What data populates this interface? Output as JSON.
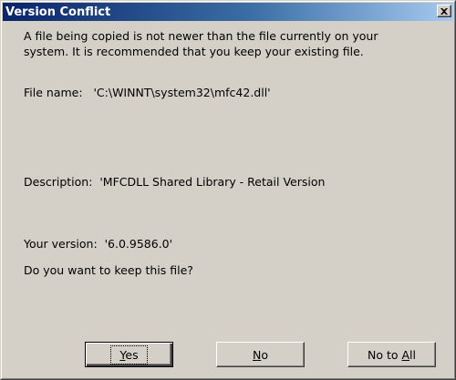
{
  "window": {
    "title": "Version Conflict",
    "close_icon": "close-icon"
  },
  "message": {
    "line1": "A file being copied is not newer than the file currently on your",
    "line2": "system. It is recommended that you keep your existing file."
  },
  "file": {
    "label": "File name:",
    "value": "'C:\\WINNT\\system32\\mfc42.dll'"
  },
  "description": {
    "label": "Description:",
    "value": "'MFCDLL Shared Library - Retail Version"
  },
  "version": {
    "label": "Your version:",
    "value": "'6.0.9586.0'"
  },
  "question": "Do you want to keep this file?",
  "buttons": {
    "yes": {
      "mnemonic": "Y",
      "rest": "es"
    },
    "no": {
      "mnemonic": "N",
      "rest": "o"
    },
    "no_to_all": {
      "prefix": "No to ",
      "mnemonic": "A",
      "rest": "ll"
    }
  }
}
